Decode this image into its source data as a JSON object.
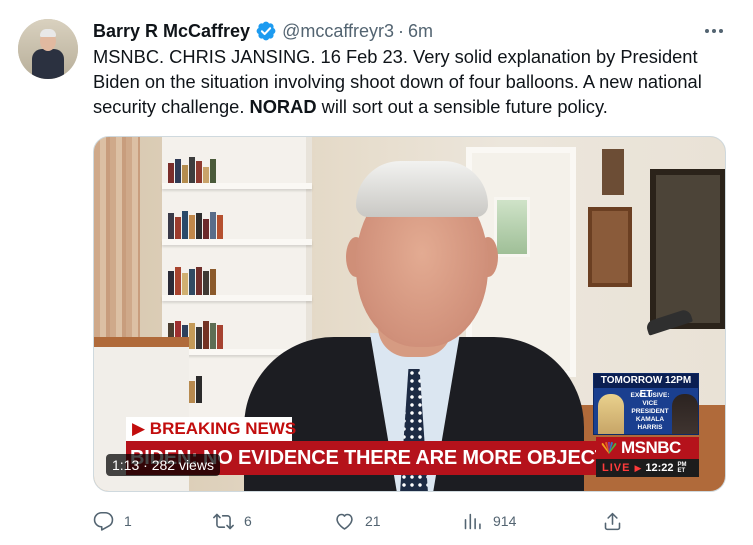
{
  "tweet": {
    "author_name": "Barry R McCaffrey",
    "handle": "@mccaffreyr3",
    "separator": "·",
    "time": "6m",
    "verified_icon": "verified-badge-icon",
    "more_icon": "more-options-icon",
    "text_part1": "MSNBC. CHRIS JANSING. 16 Feb 23. Very solid explanation by President Biden on the situation involving shoot down of four balloons. A new national security challenge. ",
    "text_bold": "NORAD",
    "text_part2": " will sort out a sensible future policy."
  },
  "video": {
    "breaking_label": "BREAKING NEWS",
    "headline": "BIDEN: NO EVIDENCE THERE ARE MORE OBJECTS IN SKY",
    "promo_time": "TOMORROW 12PM ET",
    "promo_text": "EXCLUSIVE: VICE PRESIDENT KAMALA HARRIS",
    "network": "MSNBC",
    "live_label": "LIVE",
    "live_arrow": "▶",
    "live_time": "12:22",
    "live_zone": "PM ET",
    "duration": "1:13 · 282 views"
  },
  "actions": {
    "replies": {
      "icon": "reply-icon",
      "count": "1"
    },
    "retweets": {
      "icon": "retweet-icon",
      "count": "6"
    },
    "likes": {
      "icon": "like-icon",
      "count": "21"
    },
    "views": {
      "icon": "analytics-icon",
      "count": "914"
    },
    "share": {
      "icon": "share-icon"
    }
  },
  "colors": {
    "text_primary": "#0f1419",
    "text_secondary": "#536471",
    "verified_blue": "#1d9bf0",
    "msnbc_red": "#b5121b"
  }
}
